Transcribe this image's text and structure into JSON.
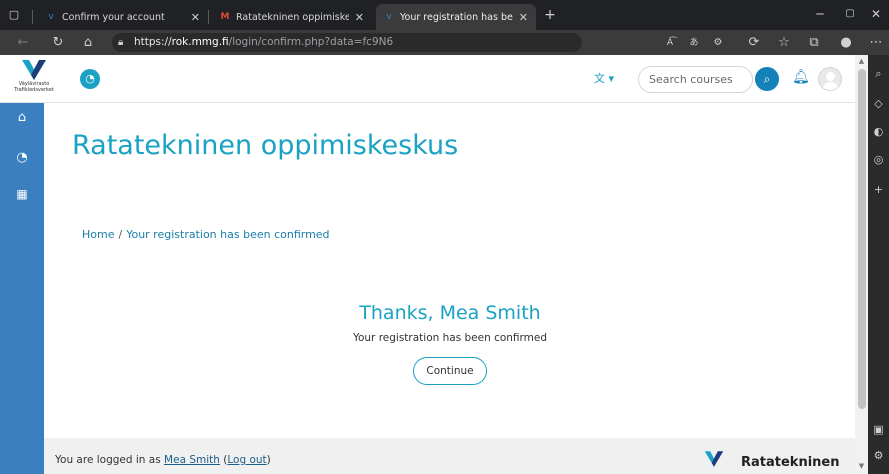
{
  "browser": {
    "tabs": [
      {
        "title": "Confirm your account",
        "favicon": "moodle-v-icon"
      },
      {
        "title": "Ratatekninen oppimiskeskus: acc",
        "favicon": "gmail-icon"
      },
      {
        "title": "Your registration has been confir",
        "favicon": "moodle-v-icon"
      }
    ],
    "url": {
      "scheme": "https://",
      "domain": "rok.mmg.fi",
      "path": "/login/confirm.php?data=fc9N6"
    }
  },
  "header": {
    "logo_line1": "Väylävirasto",
    "logo_line2": "Trafikledsverket",
    "search_placeholder": "Search courses"
  },
  "main": {
    "site_title": "Ratatekninen oppimiskeskus",
    "breadcrumb": {
      "home": "Home",
      "separator": "/",
      "current": "Your registration has been confirmed"
    },
    "thanks": "Thanks, Mea Smith",
    "message": "Your registration has been confirmed",
    "continue_label": "Continue"
  },
  "footer": {
    "logged_prefix": "You are logged in as ",
    "user": "Mea Smith",
    "logout_open": " (",
    "logout": "Log out",
    "logout_close": ")",
    "brand": "Ratatekninen"
  },
  "colors": {
    "accent": "#1aa2c4",
    "nav_blue": "#3a7fbf",
    "button_blue": "#1481b8"
  }
}
